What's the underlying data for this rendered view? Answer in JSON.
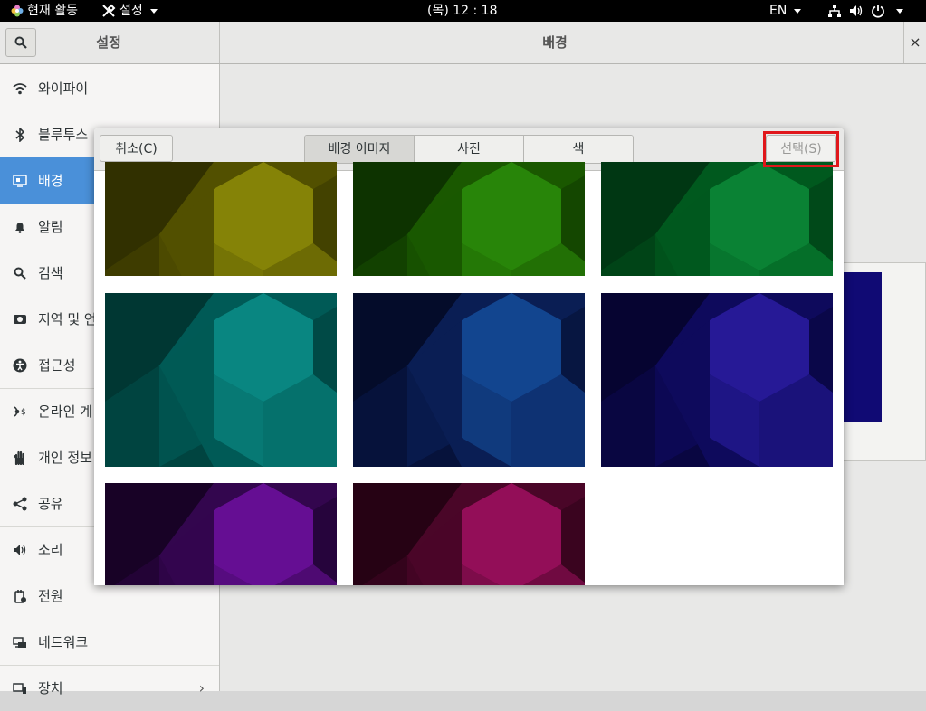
{
  "topbar": {
    "activities": "현재 활동",
    "app_menu": "설정",
    "clock": "(목) 12 : 18",
    "lang": "EN"
  },
  "header": {
    "left_title": "설정",
    "right_title": "배경",
    "close": "×"
  },
  "sidebar": {
    "items": [
      {
        "label": "와이파이",
        "icon": "wifi-icon"
      },
      {
        "label": "블루투스",
        "icon": "bluetooth-icon"
      },
      {
        "label": "배경",
        "icon": "background-icon",
        "active": true
      },
      {
        "label": "알림",
        "icon": "bell-icon"
      },
      {
        "label": "검색",
        "icon": "search-icon"
      },
      {
        "label": "지역 및 언",
        "icon": "region-icon"
      },
      {
        "label": "접근성",
        "icon": "accessibility-icon"
      },
      {
        "label": "온라인 계",
        "icon": "online-accounts-icon"
      },
      {
        "label": "개인 정보",
        "icon": "hand-icon"
      },
      {
        "label": "공유",
        "icon": "share-icon"
      },
      {
        "label": "소리",
        "icon": "sound-icon"
      },
      {
        "label": "전원",
        "icon": "power-icon"
      },
      {
        "label": "네트워크",
        "icon": "network-icon"
      },
      {
        "label": "장치",
        "icon": "devices-icon"
      }
    ]
  },
  "dialog": {
    "cancel": "취소(C)",
    "tabs": [
      "배경 이미지",
      "사진",
      "색"
    ],
    "select": "선택(S)",
    "thumbnails": [
      {
        "base": "#525000",
        "light": "#8e8c08",
        "dark": "#2e2c00"
      },
      {
        "base": "#1a5800",
        "light": "#2c8d0a",
        "dark": "#0c3000"
      },
      {
        "base": "#00591e",
        "light": "#0c8a38",
        "dark": "#003312"
      },
      {
        "base": "#005a56",
        "light": "#0b8e88",
        "dark": "#003330"
      },
      {
        "base": "#0a1e54",
        "light": "#144c9a",
        "dark": "#030a26"
      },
      {
        "base": "#0e0a5c",
        "light": "#2a1ca0",
        "dark": "#05032c"
      },
      {
        "base": "#33064e",
        "light": "#6e10a0",
        "dark": "#150222"
      },
      {
        "base": "#4a0628",
        "light": "#a01060",
        "dark": "#220212"
      }
    ]
  },
  "accent": "#4a90d9",
  "highlight_color": "#e0171b"
}
